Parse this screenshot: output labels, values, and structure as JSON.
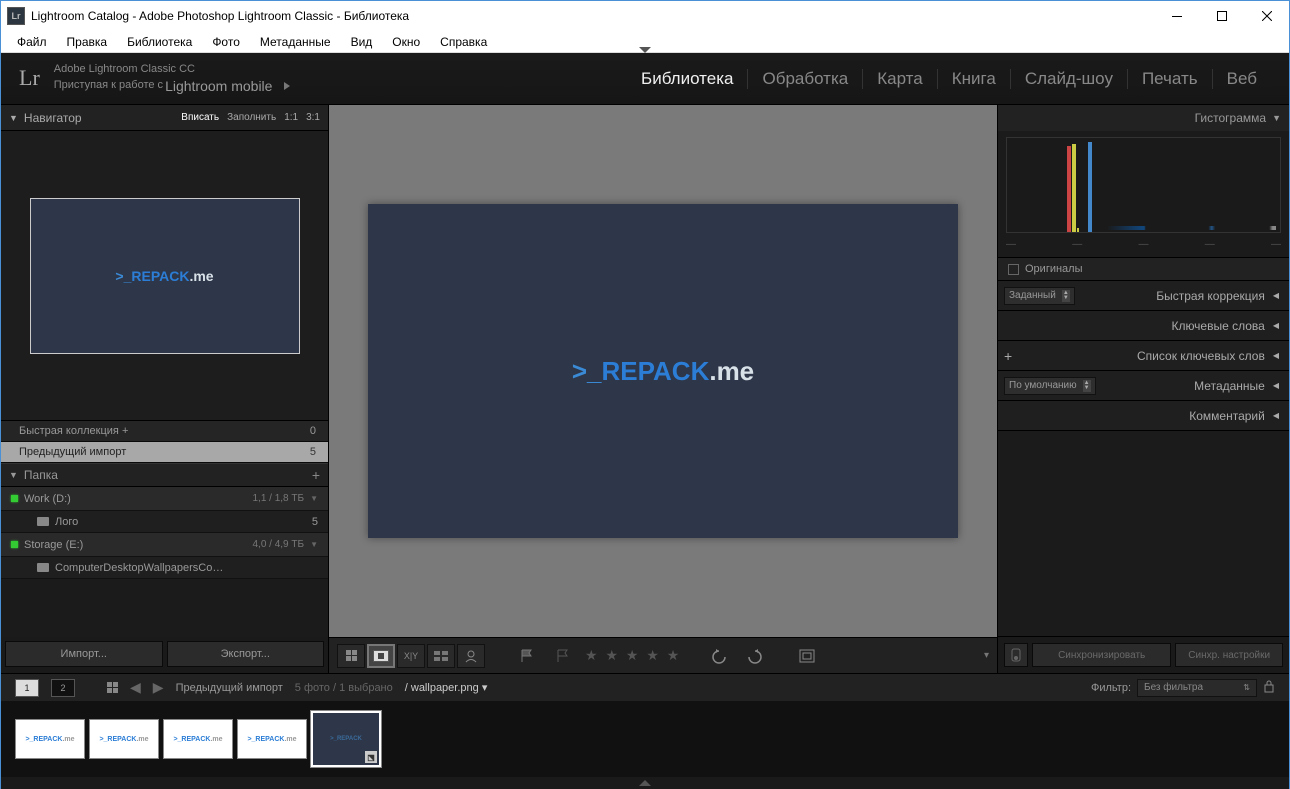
{
  "window": {
    "title": "Lightroom Catalog - Adobe Photoshop Lightroom Classic - Библиотека"
  },
  "menu": [
    "Файл",
    "Правка",
    "Библиотека",
    "Фото",
    "Метаданные",
    "Вид",
    "Окно",
    "Справка"
  ],
  "brand": {
    "logo": "Lr",
    "line1": "Adobe Lightroom Classic CC",
    "line2a": "Приступая к работе с ",
    "line2b": "Lightroom mobile"
  },
  "modules": [
    {
      "label": "Библиотека",
      "active": true
    },
    {
      "label": "Обработка",
      "active": false
    },
    {
      "label": "Карта",
      "active": false
    },
    {
      "label": "Книга",
      "active": false
    },
    {
      "label": "Слайд-шоу",
      "active": false
    },
    {
      "label": "Печать",
      "active": false
    },
    {
      "label": "Веб",
      "active": false
    }
  ],
  "navigator": {
    "title": "Навигатор",
    "opts": [
      {
        "l": "Вписать",
        "a": true
      },
      {
        "l": "Заполнить",
        "a": false
      },
      {
        "l": "1:1",
        "a": false
      },
      {
        "l": "3:1",
        "a": false
      }
    ]
  },
  "preview_text": {
    "prefix": ">_",
    "main": "REPACK",
    "suffix": ".me"
  },
  "catalog": [
    {
      "label": "Быстрая коллекция  +",
      "count": "0",
      "sel": false
    },
    {
      "label": "Предыдущий импорт",
      "count": "5",
      "sel": true
    }
  ],
  "folders": {
    "title": "Папка",
    "vols": [
      {
        "name": "Work (D:)",
        "size": "1,1 / 1,8 ТБ",
        "items": [
          {
            "name": "Лого",
            "count": "5"
          }
        ]
      },
      {
        "name": "Storage (E:)",
        "size": "4,0 / 4,9 ТБ",
        "items": [
          {
            "name": "ComputerDesktopWallpapersCo…",
            "count": ""
          }
        ]
      }
    ]
  },
  "left_buttons": {
    "import": "Импорт...",
    "export": "Экспорт..."
  },
  "toolbar_right_chev": "▾",
  "right": {
    "hist": "Гистограмма",
    "orig": "Оригиналы",
    "rows": [
      {
        "label": "Быстрая коррекция",
        "left_dd": "Заданный"
      },
      {
        "label": "Ключевые слова"
      },
      {
        "label": "Список ключевых слов",
        "plus": true
      },
      {
        "label": "Метаданные",
        "left_dd": "По умолчанию"
      },
      {
        "label": "Комментарий"
      }
    ],
    "sync": "Синхронизировать",
    "sync_settings": "Синхр. настройки"
  },
  "filmtop": {
    "mon1": "1",
    "mon2": "2",
    "breadcrumb": "Предыдущий импорт",
    "counts": "5 фото  /  1 выбрано",
    "file": "wallpaper.png",
    "filter_label": "Фильтр:",
    "filter_value": "Без фильтра"
  },
  "stars": "★ ★ ★ ★ ★"
}
